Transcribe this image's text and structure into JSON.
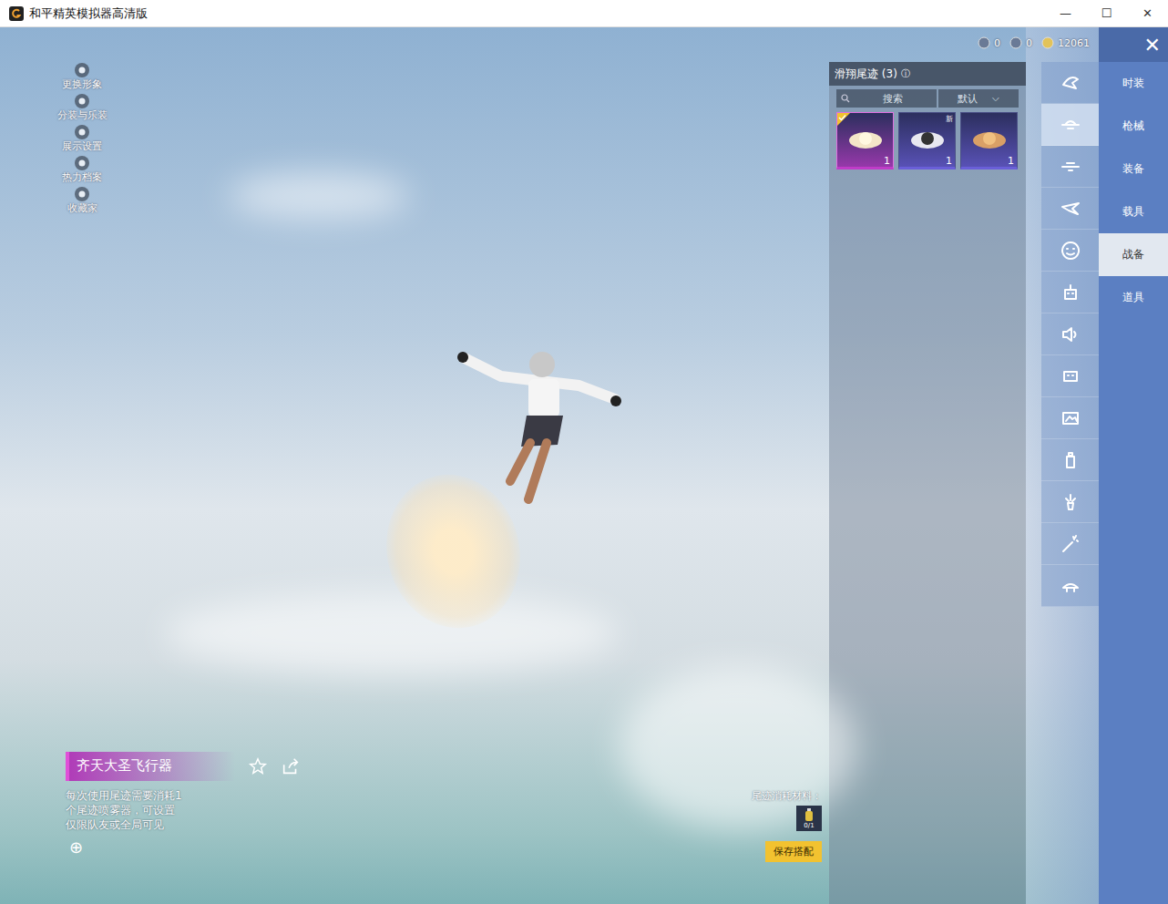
{
  "window": {
    "title": "和平精英模拟器高清版",
    "controls": [
      "—",
      "☐",
      "✕"
    ]
  },
  "currencies": [
    {
      "amount": "0"
    },
    {
      "amount": "0"
    },
    {
      "amount": "12061"
    }
  ],
  "close": "✕",
  "side_menu": [
    {
      "label": "更换形象"
    },
    {
      "label": "分装与乐装"
    },
    {
      "label": "展示设置"
    },
    {
      "label": "热力档案"
    },
    {
      "label": "收藏家"
    }
  ],
  "panel": {
    "title": "滑翔尾迹 (3)",
    "info": "ⓘ",
    "search": {
      "placeholder": "搜索"
    },
    "sort": {
      "value": "默认",
      "arrow": "⌵"
    }
  },
  "items": [
    {
      "count": "1",
      "selected": true,
      "badge": "",
      "color": "#c03cc8"
    },
    {
      "count": "1",
      "selected": false,
      "badge": "新",
      "color": "#6a5fd8"
    },
    {
      "count": "1",
      "selected": false,
      "badge": "",
      "color": "#6a5fd8"
    }
  ],
  "icon_tabs": [
    {
      "selected": false
    },
    {
      "selected": true
    },
    {
      "selected": false
    },
    {
      "selected": false
    },
    {
      "selected": false
    },
    {
      "selected": false
    },
    {
      "selected": false
    },
    {
      "selected": false
    },
    {
      "selected": false
    },
    {
      "selected": false
    },
    {
      "selected": false
    },
    {
      "selected": false
    },
    {
      "selected": false
    }
  ],
  "categories": [
    {
      "label": "时装",
      "selected": false
    },
    {
      "label": "枪械",
      "selected": false
    },
    {
      "label": "装备",
      "selected": false
    },
    {
      "label": "载具",
      "selected": false
    },
    {
      "label": "战备",
      "selected": true
    },
    {
      "label": "道具",
      "selected": false
    }
  ],
  "detail": {
    "name": "齐天大圣飞行器",
    "description_lines": [
      "每次使用尾迹需要消耗1",
      "个尾迹喷雾器，可设置",
      "仅限队友或全局可见"
    ],
    "expand": "⊕"
  },
  "material": {
    "label": "尾迹消耗材料：",
    "count": "0/1"
  },
  "save_button": "保存搭配"
}
